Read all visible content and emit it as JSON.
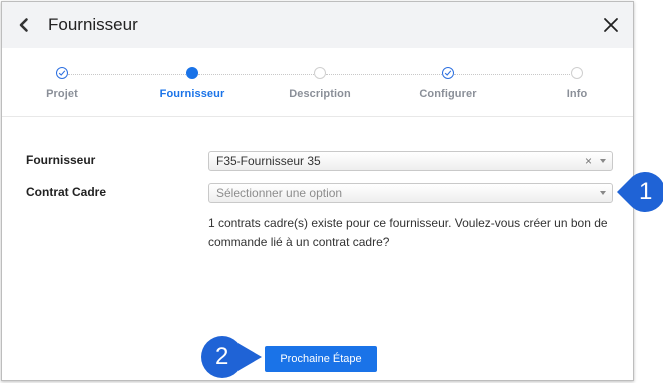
{
  "header": {
    "title": "Fournisseur",
    "back_icon": "chevron-left-icon",
    "close_icon": "close-icon"
  },
  "stepper": {
    "steps": [
      {
        "label": "Projet",
        "state": "done"
      },
      {
        "label": "Fournisseur",
        "state": "active"
      },
      {
        "label": "Description",
        "state": "todo"
      },
      {
        "label": "Configurer",
        "state": "done"
      },
      {
        "label": "Info",
        "state": "todo"
      }
    ]
  },
  "form": {
    "supplier_label": "Fournisseur",
    "supplier_value": "F35-Fournisseur 35",
    "supplier_clear": "×",
    "contract_label": "Contrat Cadre",
    "contract_placeholder": "Sélectionner une option",
    "info_text": "1 contrats cadre(s) existe pour ce fournisseur. Voulez-vous créer un bon de commande lié à un contrat cadre?"
  },
  "footer": {
    "next_label": "Prochaine Étape"
  },
  "callouts": [
    {
      "number": "1"
    },
    {
      "number": "2"
    }
  ],
  "colors": {
    "accent": "#1a73e8",
    "callout": "#1f63d6",
    "header_bg": "#f2f3f5",
    "inactive_step_text": "#8a8f98"
  }
}
